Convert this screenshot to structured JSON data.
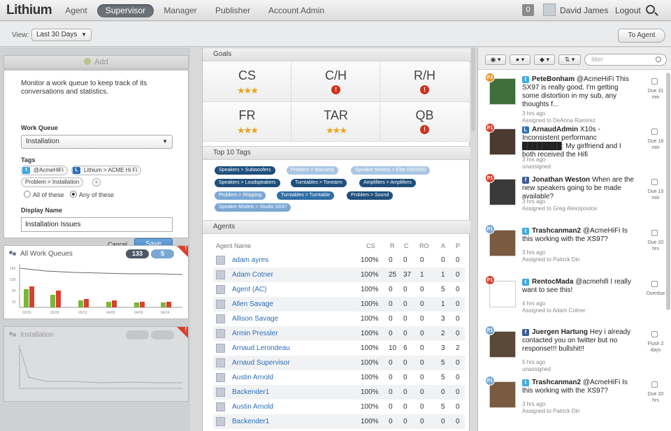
{
  "topnav": {
    "logo": "Lithium",
    "tabs": [
      {
        "label": "Agent",
        "active": false
      },
      {
        "label": "Supervisor",
        "active": true
      },
      {
        "label": "Manager",
        "active": false
      },
      {
        "label": "Publisher",
        "active": false
      },
      {
        "label": "Account Admin",
        "active": false
      }
    ],
    "notification_count": "0",
    "user_name": "David James",
    "logout_label": "Logout"
  },
  "toolbar": {
    "view_label": "View:",
    "view_value": "Last 30 Days",
    "to_agent_label": "To Agent"
  },
  "left": {
    "add_label": "Add",
    "form": {
      "description": "Monitor a work queue to keep track of its conversations and statistics.",
      "work_queue_label": "Work Queue",
      "work_queue_value": "Installation",
      "tags_label": "Tags",
      "tags": [
        "@AcmeHiFi",
        "Lithium > ACME Hi Fi",
        "Problem > Installation"
      ],
      "radio_all": "All of these",
      "radio_any": "Any of these",
      "display_name_label": "Display Name",
      "display_name_value": "Installation Issues",
      "cancel_label": "Cancel",
      "save_label": "Save"
    },
    "all_queues": {
      "title": "All Work Queues",
      "badge_dark": "133",
      "badge_light": "5",
      "xlabels": [
        "03/20",
        "03/26",
        "03/31",
        "04/06",
        "04/09",
        "04/14"
      ]
    },
    "installation": {
      "title": "Installation"
    }
  },
  "middle": {
    "goals_header": "Goals",
    "goals": [
      {
        "name": "CS",
        "status": "stars"
      },
      {
        "name": "C/H",
        "status": "warning"
      },
      {
        "name": "R/H",
        "status": "warning"
      },
      {
        "name": "FR",
        "status": "stars"
      },
      {
        "name": "TAR",
        "status": "stars"
      },
      {
        "name": "QB",
        "status": "warning"
      }
    ],
    "tags_header": "Top 10 Tags",
    "tag_cloud": [
      {
        "label": "Speakers > Subwoofers",
        "tone": "dark"
      },
      {
        "label": "Problem > Warranty",
        "tone": "xlight"
      },
      {
        "label": "Speaker Models > Elite EMS900",
        "tone": "xlight"
      },
      {
        "label": "Speakers > Loudspeakers",
        "tone": "dark"
      },
      {
        "label": "Turntables > Tonearm",
        "tone": "dark"
      },
      {
        "label": "Amplifiers > Amplifiers",
        "tone": "dark"
      },
      {
        "label": "Problem > Shipping",
        "tone": "light"
      },
      {
        "label": "Turntables > Turntable",
        "tone": "medium"
      },
      {
        "label": "Problem > Sound",
        "tone": "dark"
      },
      {
        "label": "Speaker Models > Studio SX97",
        "tone": "light"
      }
    ],
    "agents_header": "Agents",
    "agent_columns": [
      "Agent Name",
      "CS",
      "R",
      "C",
      "RO",
      "A",
      "P"
    ],
    "agents": [
      [
        "adam ayres",
        "100%",
        "0",
        "0",
        "0",
        "0",
        "0"
      ],
      [
        "Adam Cotner",
        "100%",
        "25",
        "37",
        "1",
        "1",
        "0"
      ],
      [
        "Agent (AC)",
        "100%",
        "0",
        "0",
        "0",
        "5",
        "0"
      ],
      [
        "Allen Savage",
        "100%",
        "0",
        "0",
        "0",
        "1",
        "0"
      ],
      [
        "Allison Savage",
        "100%",
        "0",
        "0",
        "0",
        "3",
        "0"
      ],
      [
        "Armin Pressler",
        "100%",
        "0",
        "0",
        "0",
        "2",
        "0"
      ],
      [
        "Arnaud Lerondeau",
        "100%",
        "10",
        "6",
        "0",
        "3",
        "2"
      ],
      [
        "Arnaud Supervisor",
        "100%",
        "0",
        "0",
        "0",
        "5",
        "0"
      ],
      [
        "Austin Arnold",
        "100%",
        "0",
        "0",
        "0",
        "5",
        "0"
      ],
      [
        "Backender1",
        "100%",
        "0",
        "0",
        "0",
        "0",
        "0"
      ],
      [
        "Austin Arnold",
        "100%",
        "0",
        "0",
        "0",
        "5",
        "0"
      ],
      [
        "Backender1",
        "100%",
        "0",
        "0",
        "0",
        "0",
        "0"
      ]
    ]
  },
  "right": {
    "filter_placeholder": "filter",
    "tickets": [
      {
        "priority": "P2",
        "pri_color": "#e8922a",
        "source": "twitter",
        "author": "PeteBonham",
        "text": "@AcmeHiFi This SX97 is really good. I'm getting some distortion in my sub, any thoughts f...",
        "time": "3 hrs ago",
        "assigned": "Assigned to DeAnna Ramirez",
        "due": "Due 31 min"
      },
      {
        "priority": "P1",
        "pri_color": "#d9412e",
        "source": "lithium",
        "author": "ArnaudAdmin",
        "text": "X10s - Inconsistent performanc ████████: My girlfriend and I both received the Hifi",
        "time": "3 hrs ago",
        "assigned": "unassigned",
        "due": "Due 18 min"
      },
      {
        "priority": "P1",
        "pri_color": "#d9412e",
        "source": "facebook",
        "author": "Jonathan Weston",
        "text": "When are the new speakers going to be made available?",
        "time": "3 hrs ago",
        "assigned": "Assigned to Greg Alexopoulos",
        "due": "Due 13 min"
      },
      {
        "priority": "P1",
        "pri_color": "#7aa7d4",
        "source": "twitter",
        "author": "Trashcanman2",
        "text": "@AcmeHiFi Is this working with the XS97?",
        "time": "3 hrs ago",
        "assigned": "Assigned to Patrick Din",
        "due": "Due 20 hrs"
      },
      {
        "priority": "P1",
        "pri_color": "#d9412e",
        "source": "twitter",
        "author": "RentocMada",
        "text": "@acmehifi I really want to see this!",
        "time": "4 hrs ago",
        "assigned": "Assigned to Adam Cotner",
        "due": "Overdue"
      },
      {
        "priority": "P1",
        "pri_color": "#7aa7d4",
        "source": "facebook",
        "author": "Juergen Hartung",
        "text": "Hey i already contacted you on twitter but no response!!! bullshit!!",
        "time": "5 hrs ago",
        "assigned": "unassigned",
        "due": "Flush 2 days"
      },
      {
        "priority": "P1",
        "pri_color": "#7aa7d4",
        "source": "twitter",
        "author": "Trashcanman2",
        "text": "@AcmeHiFi Is this working with the XS97?",
        "time": "3 hrs ago",
        "assigned": "Assigned to Patrick Din",
        "due": "Due 20 hrs"
      }
    ]
  },
  "colors": {
    "accent": "#3d7fc3",
    "link": "#2a6db5",
    "warning": "#d0311f",
    "star": "#f0a21b"
  }
}
